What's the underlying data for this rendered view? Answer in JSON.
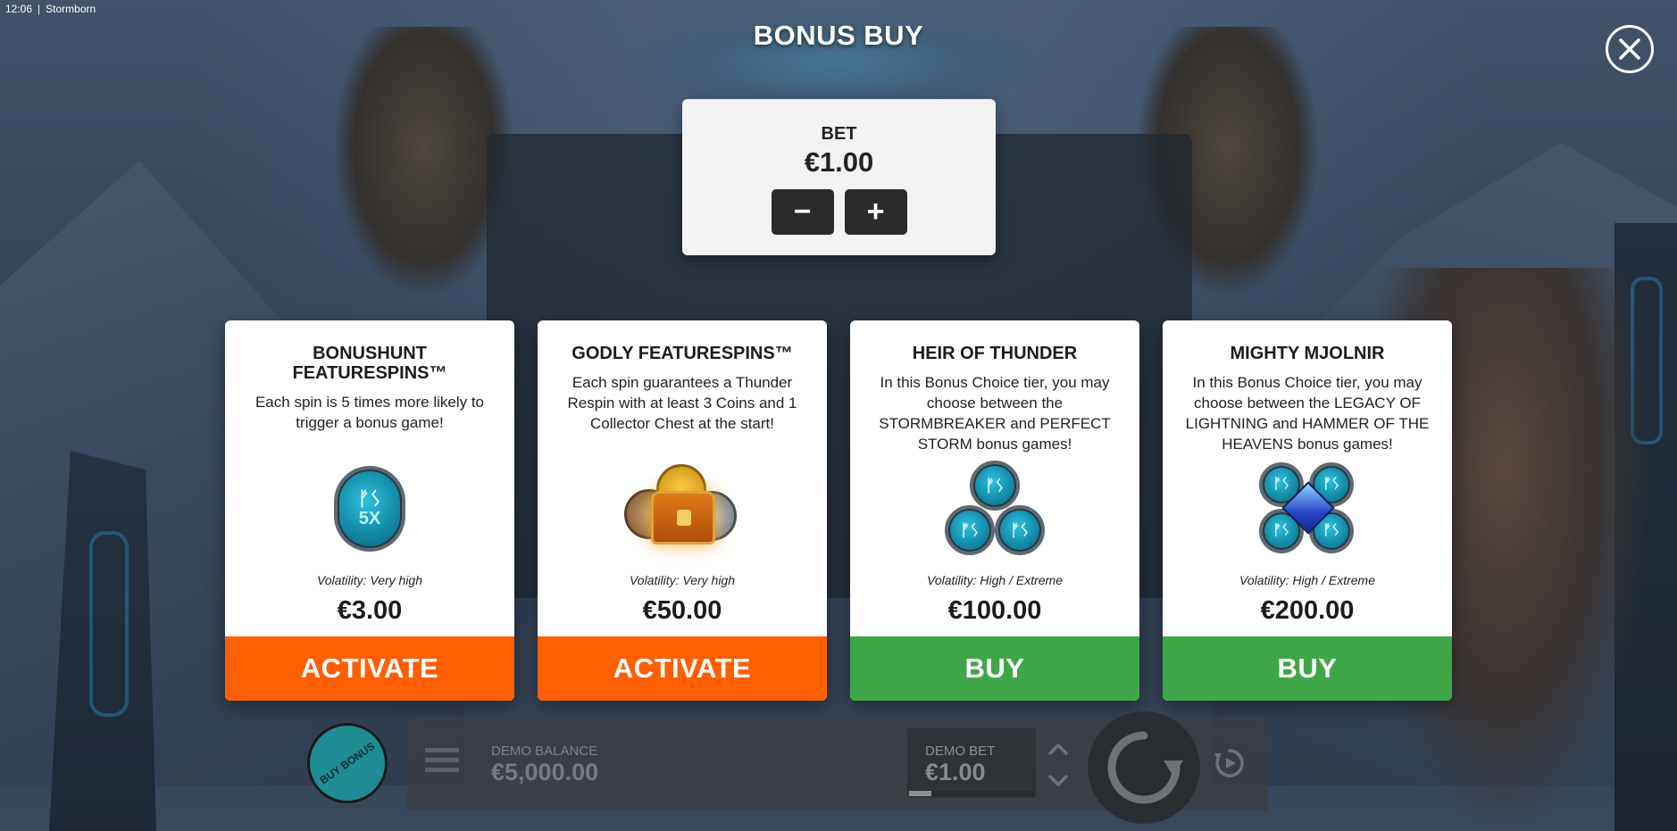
{
  "status_bar": {
    "time": "12:06",
    "app_name": "Stormborn"
  },
  "header": {
    "title": "BONUS BUY",
    "close_icon": "close-icon"
  },
  "bet": {
    "label": "BET",
    "value": "€1.00",
    "decrease_symbol": "−",
    "increase_symbol": "+"
  },
  "cards": [
    {
      "title": "BONUSHUNT FEATURESPINS™",
      "description": "Each spin is 5 times more likely to trigger a bonus game!",
      "icon": "rune-coin-5x-icon",
      "icon_rune": "ᚠᛊ",
      "icon_multiplier": "5X",
      "volatility": "Volatility: Very high",
      "price": "€3.00",
      "action": "ACTIVATE",
      "action_color": "#ff5f00"
    },
    {
      "title": "GODLY FEATURESPINS™",
      "description": "Each spin guarantees a Thunder Respin with at least 3 Coins and 1 Collector Chest at the start!",
      "icon": "treasure-chest-icon",
      "volatility": "Volatility: Very high",
      "price": "€50.00",
      "action": "ACTIVATE",
      "action_color": "#ff5f00"
    },
    {
      "title": "HEIR OF THUNDER",
      "description": "In this Bonus Choice tier, you may choose between the STORMBREAKER and PERFECT STORM bonus games!",
      "icon": "rune-coins-3-icon",
      "icon_rune": "ᚠᛊ",
      "volatility": "Volatility: High / Extreme",
      "price": "€100.00",
      "action": "BUY",
      "action_color": "#3fa648"
    },
    {
      "title": "MIGHTY MJOLNIR",
      "description": "In this Bonus Choice tier, you may choose between the LEGACY OF LIGHTNING and HAMMER OF THE HEAVENS bonus games!",
      "icon": "rune-coins-4-gem-icon",
      "icon_rune": "ᚠᛊ",
      "volatility": "Volatility: High / Extreme",
      "price": "€200.00",
      "action": "BUY",
      "action_color": "#3fa648"
    }
  ],
  "bottom_bar": {
    "buy_bonus_label": "BUY BONUS",
    "menu_icon": "menu-icon",
    "demo_balance_label": "DEMO BALANCE",
    "demo_balance_value": "€5,000.00",
    "demo_bet_label": "DEMO BET",
    "demo_bet_value": "€1.00",
    "bet_level_fraction": 0.18,
    "spin_icon": "spin-icon",
    "autoplay_icon": "autoplay-icon"
  },
  "colors": {
    "activate": "#ff5f00",
    "buy": "#3fa648",
    "rune": "#128aa8"
  }
}
